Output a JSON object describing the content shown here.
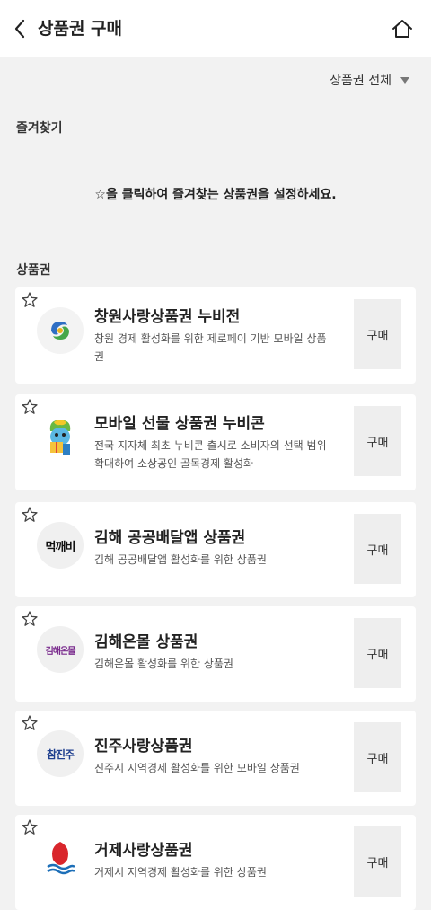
{
  "header": {
    "title": "상품권 구매"
  },
  "filter": {
    "selected": "상품권 전체"
  },
  "favorites": {
    "label": "즐겨찾기",
    "empty_message": "☆을 클릭하여 즐겨찾는 상품권을 설정하세요."
  },
  "vouchers": {
    "label": "상품권",
    "buy_label": "구매",
    "items": [
      {
        "name": "창원사랑상품권 누비전",
        "desc": "창원 경제 활성화를 위한 제로페이 기반 모바일 상품권"
      },
      {
        "name": "모바일 선물 상품권 누비콘",
        "desc": "전국 지자체 최초 누비콘 출시로 소비자의 선택 범위 확대하여 소상공인 골목경제 활성화"
      },
      {
        "name": "김해 공공배달앱 상품권",
        "desc": "김해 공공배달앱 활성화를 위한 상품권",
        "logo_text": "먹깨비"
      },
      {
        "name": "김해온몰 상품권",
        "desc": "김해온몰 활성화를 위한 상품권",
        "logo_text": "김해온몰"
      },
      {
        "name": "진주사랑상품권",
        "desc": "진주시 지역경제 활성화를 위한 모바일 상품권",
        "logo_text": "참진주"
      },
      {
        "name": "거제사랑상품권",
        "desc": "거제시 지역경제 활성화를 위한 상품권"
      }
    ]
  }
}
